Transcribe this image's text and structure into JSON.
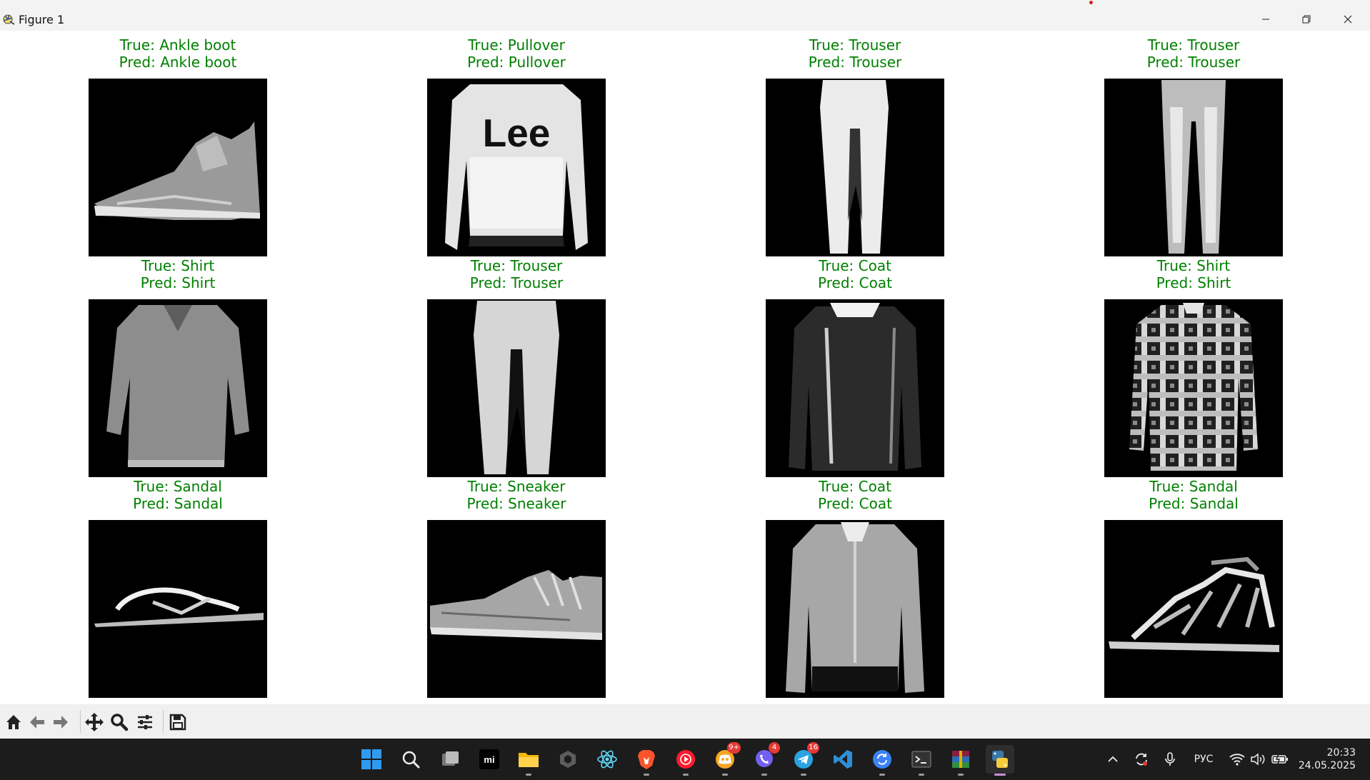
{
  "window": {
    "title": "Figure 1"
  },
  "panels": [
    {
      "true_label": "True: Ankle boot",
      "pred_label": "Pred: Ankle boot",
      "image": "ankle-boot"
    },
    {
      "true_label": "True: Pullover",
      "pred_label": "Pred: Pullover",
      "image": "pullover"
    },
    {
      "true_label": "True: Trouser",
      "pred_label": "Pred: Trouser",
      "image": "trouser"
    },
    {
      "true_label": "True: Trouser",
      "pred_label": "Pred: Trouser",
      "image": "trouser"
    },
    {
      "true_label": "True: Shirt",
      "pred_label": "Pred: Shirt",
      "image": "shirt"
    },
    {
      "true_label": "True: Trouser",
      "pred_label": "Pred: Trouser",
      "image": "trouser"
    },
    {
      "true_label": "True: Coat",
      "pred_label": "Pred: Coat",
      "image": "coat"
    },
    {
      "true_label": "True: Shirt",
      "pred_label": "Pred: Shirt",
      "image": "shirt-plaid"
    },
    {
      "true_label": "True: Sandal",
      "pred_label": "Pred: Sandal",
      "image": "sandal"
    },
    {
      "true_label": "True: Sneaker",
      "pred_label": "Pred: Sneaker",
      "image": "sneaker"
    },
    {
      "true_label": "True: Coat",
      "pred_label": "Pred: Coat",
      "image": "coat-light"
    },
    {
      "true_label": "True: Sandal",
      "pred_label": "Pred: Sandal",
      "image": "sandal-strappy"
    }
  ],
  "colors": {
    "label_correct": "#008000",
    "image_bg": "#000000",
    "toolbar_bg": "#f0f0f0",
    "taskbar_bg": "#1c1c1c"
  },
  "toolbar": {
    "buttons": [
      "home-icon",
      "back-icon",
      "forward-icon",
      "pan-icon",
      "zoom-icon",
      "configure-subplots-icon",
      "save-icon"
    ]
  },
  "taskbar": {
    "apps": [
      "windows-start-icon",
      "search-icon",
      "task-view-icon",
      "mi-icon",
      "file-explorer-icon",
      "unity-icon",
      "react-icon",
      "brave-icon",
      "youtube-music-icon",
      "discord-icon",
      "viber-icon",
      "telegram-icon",
      "vscode-icon",
      "sync-icon",
      "terminal-icon",
      "winrar-icon",
      "python-icon"
    ],
    "badges": {
      "discord": "9+",
      "viber": "4",
      "telegram": "16"
    },
    "language": "РУС",
    "time": "20:33",
    "date": "24.05.2025"
  }
}
